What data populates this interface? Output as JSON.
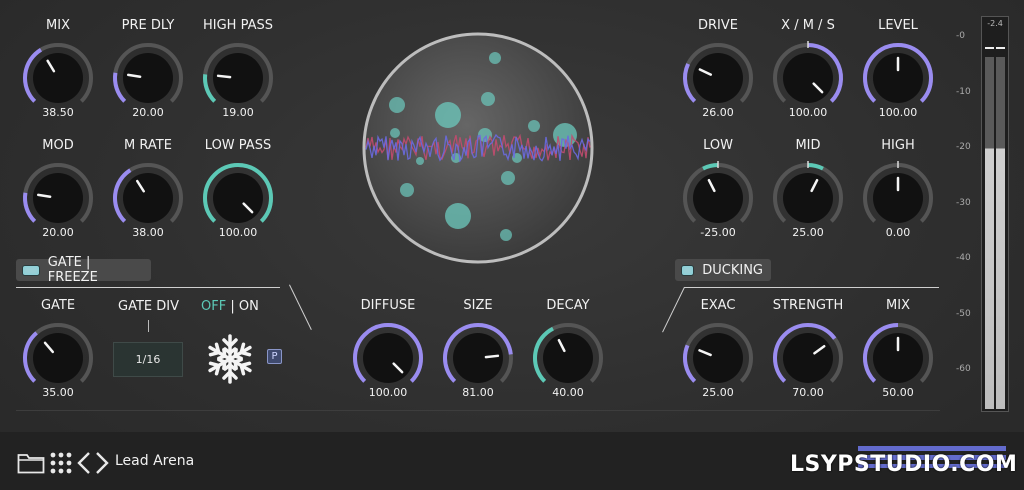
{
  "colors": {
    "accent_purple": "#9a8cf0",
    "accent_teal": "#5cc9b6",
    "knob_body": "#111111",
    "track": "#555555"
  },
  "knobs": [
    {
      "id": "mix",
      "label": "MIX",
      "value": "38.50",
      "pos": 0.385,
      "color": "purple"
    },
    {
      "id": "pre-dly",
      "label": "PRE DLY",
      "value": "20.00",
      "pos": 0.2,
      "color": "purple"
    },
    {
      "id": "high-pass",
      "label": "HIGH PASS",
      "value": "19.00",
      "pos": 0.19,
      "color": "teal"
    },
    {
      "id": "mod",
      "label": "MOD",
      "value": "20.00",
      "pos": 0.2,
      "color": "purple"
    },
    {
      "id": "m-rate",
      "label": "M RATE",
      "value": "38.00",
      "pos": 0.38,
      "color": "purple"
    },
    {
      "id": "low-pass",
      "label": "LOW PASS",
      "value": "100.00",
      "pos": 1.0,
      "color": "teal"
    },
    {
      "id": "gate",
      "label": "GATE",
      "value": "35.00",
      "pos": 0.35,
      "color": "purple"
    },
    {
      "id": "diffuse",
      "label": "DIFFUSE",
      "value": "100.00",
      "pos": 1.0,
      "color": "purple"
    },
    {
      "id": "size",
      "label": "SIZE",
      "value": "81.00",
      "pos": 0.81,
      "color": "purple"
    },
    {
      "id": "decay",
      "label": "DECAY",
      "value": "40.00",
      "pos": 0.4,
      "color": "teal"
    },
    {
      "id": "drive",
      "label": "DRIVE",
      "value": "26.00",
      "pos": 0.26,
      "color": "purple"
    },
    {
      "id": "xms",
      "label": "X / M / S",
      "value": "100.00",
      "pos": 1.0,
      "color": "purple",
      "bipolar": true
    },
    {
      "id": "level",
      "label": "LEVEL",
      "value": "100.00",
      "pos": 0.5,
      "color": "purple",
      "full": true
    },
    {
      "id": "low",
      "label": "LOW",
      "value": "-25.00",
      "pos": 0.4,
      "color": "teal",
      "bipolar": true
    },
    {
      "id": "mid",
      "label": "MID",
      "value": "25.00",
      "pos": 0.6,
      "color": "teal",
      "bipolar": true
    },
    {
      "id": "high",
      "label": "HIGH",
      "value": "0.00",
      "pos": 0.5,
      "color": "teal",
      "bipolar": true
    },
    {
      "id": "exac",
      "label": "EXAC",
      "value": "25.00",
      "pos": 0.25,
      "color": "purple"
    },
    {
      "id": "strength",
      "label": "STRENGTH",
      "value": "70.00",
      "pos": 0.7,
      "color": "purple"
    },
    {
      "id": "duck-mix",
      "label": "MIX",
      "value": "50.00",
      "pos": 0.5,
      "color": "purple"
    }
  ],
  "gate_freeze": {
    "label": "GATE | FREEZE"
  },
  "ducking": {
    "label": "DUCKING"
  },
  "gate_div": {
    "label": "GATE DIV",
    "value": "1/16"
  },
  "freeze": {
    "off_label": "OFF",
    "sep": " | ",
    "on_label": "ON",
    "p_label": "P"
  },
  "meter": {
    "readout": "-2.4",
    "scale": [
      "-0",
      "-10",
      "-20",
      "-30",
      "-40",
      "-50",
      "-60"
    ]
  },
  "bottom": {
    "preset_name": "Lead Arena",
    "watermark": "LSYPSTUDIO.COM"
  }
}
